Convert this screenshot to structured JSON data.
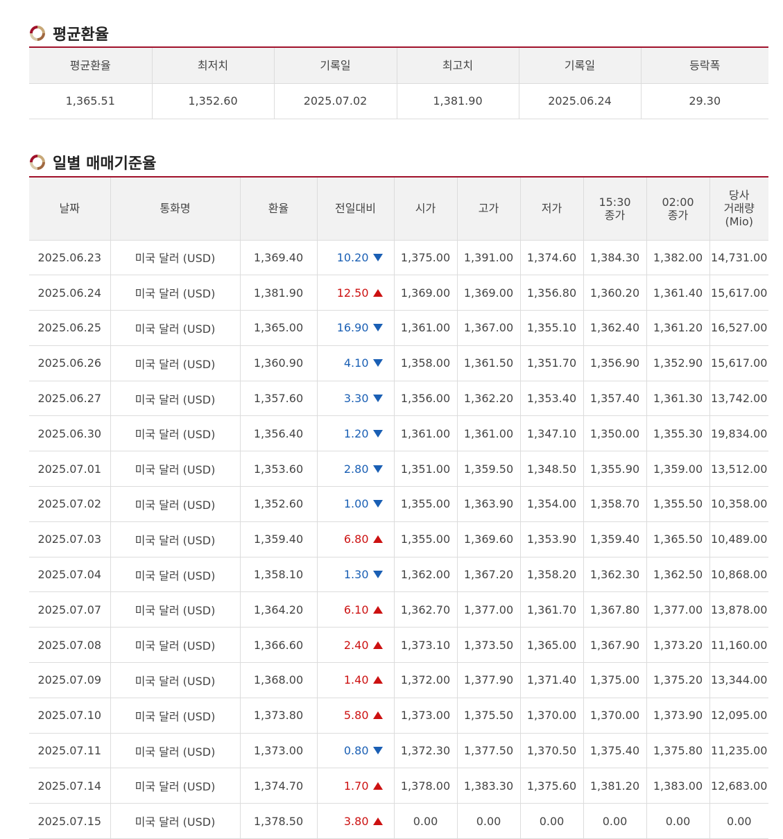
{
  "sections": {
    "average_title": "평균환율",
    "daily_title": "일별 매매기준율"
  },
  "colors": {
    "accent": "#a0102a",
    "up": "#cc1111",
    "down": "#1a5fb4"
  },
  "average": {
    "headers": [
      "평균환율",
      "최저치",
      "기록일",
      "최고치",
      "기록일",
      "등락폭"
    ],
    "values": [
      "1,365.51",
      "1,352.60",
      "2025.07.02",
      "1,381.90",
      "2025.06.24",
      "29.30"
    ]
  },
  "daily": {
    "headers": [
      "날짜",
      "통화명",
      "환율",
      "전일대비",
      "시가",
      "고가",
      "저가",
      "15:30\n종가",
      "02:00\n종가",
      "당사\n거래량\n(Mio)"
    ],
    "rows": [
      {
        "date": "2025.06.23",
        "currency": "미국 달러 (USD)",
        "rate": "1,369.40",
        "change": "10.20",
        "dir": "down",
        "open": "1,375.00",
        "high": "1,391.00",
        "low": "1,374.60",
        "close1530": "1,384.30",
        "close0200": "1,382.00",
        "volume": "14,731.00"
      },
      {
        "date": "2025.06.24",
        "currency": "미국 달러 (USD)",
        "rate": "1,381.90",
        "change": "12.50",
        "dir": "up",
        "open": "1,369.00",
        "high": "1,369.00",
        "low": "1,356.80",
        "close1530": "1,360.20",
        "close0200": "1,361.40",
        "volume": "15,617.00"
      },
      {
        "date": "2025.06.25",
        "currency": "미국 달러 (USD)",
        "rate": "1,365.00",
        "change": "16.90",
        "dir": "down",
        "open": "1,361.00",
        "high": "1,367.00",
        "low": "1,355.10",
        "close1530": "1,362.40",
        "close0200": "1,361.20",
        "volume": "16,527.00"
      },
      {
        "date": "2025.06.26",
        "currency": "미국 달러 (USD)",
        "rate": "1,360.90",
        "change": "4.10",
        "dir": "down",
        "open": "1,358.00",
        "high": "1,361.50",
        "low": "1,351.70",
        "close1530": "1,356.90",
        "close0200": "1,352.90",
        "volume": "15,617.00"
      },
      {
        "date": "2025.06.27",
        "currency": "미국 달러 (USD)",
        "rate": "1,357.60",
        "change": "3.30",
        "dir": "down",
        "open": "1,356.00",
        "high": "1,362.20",
        "low": "1,353.40",
        "close1530": "1,357.40",
        "close0200": "1,361.30",
        "volume": "13,742.00"
      },
      {
        "date": "2025.06.30",
        "currency": "미국 달러 (USD)",
        "rate": "1,356.40",
        "change": "1.20",
        "dir": "down",
        "open": "1,361.00",
        "high": "1,361.00",
        "low": "1,347.10",
        "close1530": "1,350.00",
        "close0200": "1,355.30",
        "volume": "19,834.00"
      },
      {
        "date": "2025.07.01",
        "currency": "미국 달러 (USD)",
        "rate": "1,353.60",
        "change": "2.80",
        "dir": "down",
        "open": "1,351.00",
        "high": "1,359.50",
        "low": "1,348.50",
        "close1530": "1,355.90",
        "close0200": "1,359.00",
        "volume": "13,512.00"
      },
      {
        "date": "2025.07.02",
        "currency": "미국 달러 (USD)",
        "rate": "1,352.60",
        "change": "1.00",
        "dir": "down",
        "open": "1,355.00",
        "high": "1,363.90",
        "low": "1,354.00",
        "close1530": "1,358.70",
        "close0200": "1,355.50",
        "volume": "10,358.00"
      },
      {
        "date": "2025.07.03",
        "currency": "미국 달러 (USD)",
        "rate": "1,359.40",
        "change": "6.80",
        "dir": "up",
        "open": "1,355.00",
        "high": "1,369.60",
        "low": "1,353.90",
        "close1530": "1,359.40",
        "close0200": "1,365.50",
        "volume": "10,489.00"
      },
      {
        "date": "2025.07.04",
        "currency": "미국 달러 (USD)",
        "rate": "1,358.10",
        "change": "1.30",
        "dir": "down",
        "open": "1,362.00",
        "high": "1,367.20",
        "low": "1,358.20",
        "close1530": "1,362.30",
        "close0200": "1,362.50",
        "volume": "10,868.00"
      },
      {
        "date": "2025.07.07",
        "currency": "미국 달러 (USD)",
        "rate": "1,364.20",
        "change": "6.10",
        "dir": "up",
        "open": "1,362.70",
        "high": "1,377.00",
        "low": "1,361.70",
        "close1530": "1,367.80",
        "close0200": "1,377.00",
        "volume": "13,878.00"
      },
      {
        "date": "2025.07.08",
        "currency": "미국 달러 (USD)",
        "rate": "1,366.60",
        "change": "2.40",
        "dir": "up",
        "open": "1,373.10",
        "high": "1,373.50",
        "low": "1,365.00",
        "close1530": "1,367.90",
        "close0200": "1,373.20",
        "volume": "11,160.00"
      },
      {
        "date": "2025.07.09",
        "currency": "미국 달러 (USD)",
        "rate": "1,368.00",
        "change": "1.40",
        "dir": "up",
        "open": "1,372.00",
        "high": "1,377.90",
        "low": "1,371.40",
        "close1530": "1,375.00",
        "close0200": "1,375.20",
        "volume": "13,344.00"
      },
      {
        "date": "2025.07.10",
        "currency": "미국 달러 (USD)",
        "rate": "1,373.80",
        "change": "5.80",
        "dir": "up",
        "open": "1,373.00",
        "high": "1,375.50",
        "low": "1,370.00",
        "close1530": "1,370.00",
        "close0200": "1,373.90",
        "volume": "12,095.00"
      },
      {
        "date": "2025.07.11",
        "currency": "미국 달러 (USD)",
        "rate": "1,373.00",
        "change": "0.80",
        "dir": "down",
        "open": "1,372.30",
        "high": "1,377.50",
        "low": "1,370.50",
        "close1530": "1,375.40",
        "close0200": "1,375.80",
        "volume": "11,235.00"
      },
      {
        "date": "2025.07.14",
        "currency": "미국 달러 (USD)",
        "rate": "1,374.70",
        "change": "1.70",
        "dir": "up",
        "open": "1,378.00",
        "high": "1,383.30",
        "low": "1,375.60",
        "close1530": "1,381.20",
        "close0200": "1,383.00",
        "volume": "12,683.00"
      },
      {
        "date": "2025.07.15",
        "currency": "미국 달러 (USD)",
        "rate": "1,378.50",
        "change": "3.80",
        "dir": "up",
        "open": "0.00",
        "high": "0.00",
        "low": "0.00",
        "close1530": "0.00",
        "close0200": "0.00",
        "volume": "0.00"
      }
    ]
  }
}
